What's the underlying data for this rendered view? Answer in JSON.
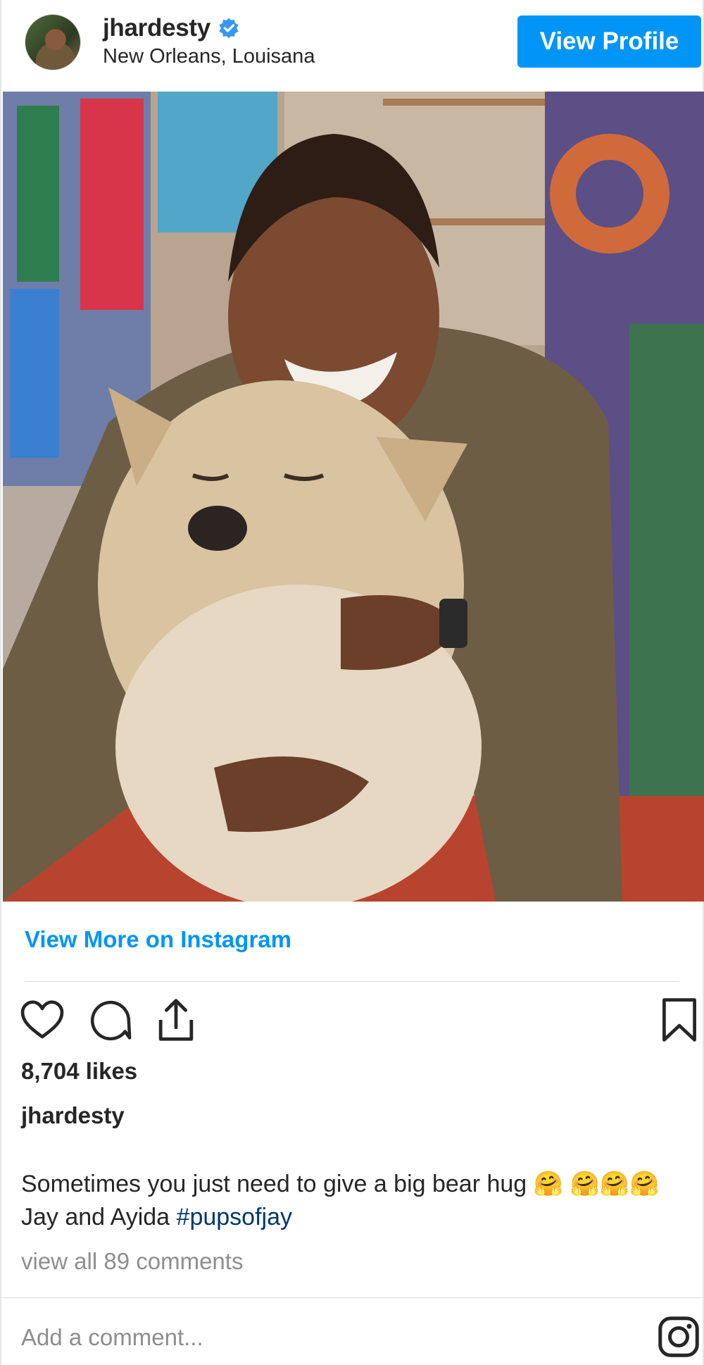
{
  "header": {
    "username": "jhardesty",
    "location": "New Orleans, Louisana",
    "view_profile_label": "View Profile"
  },
  "photo": {
    "description_icon": "photo-of-man-hugging-dog"
  },
  "links": {
    "view_more_label": "View More on Instagram"
  },
  "actions": {
    "like_icon": "heart-icon",
    "comment_icon": "comment-icon",
    "share_icon": "share-icon",
    "save_icon": "bookmark-icon"
  },
  "post": {
    "likes_text": "8,704 likes",
    "caption_user": "jhardesty",
    "caption_text": "Sometimes you just need to give a big bear hug 🤗 🤗🤗🤗 Jay and Ayida ",
    "hashtag": "#pupsofjay",
    "view_comments": "view all 89 comments"
  },
  "comment_box": {
    "placeholder": "Add a comment..."
  },
  "colors": {
    "accent": "#0095f6",
    "hashtag": "#00376b",
    "muted": "#8e8e8e",
    "text": "#262626"
  }
}
